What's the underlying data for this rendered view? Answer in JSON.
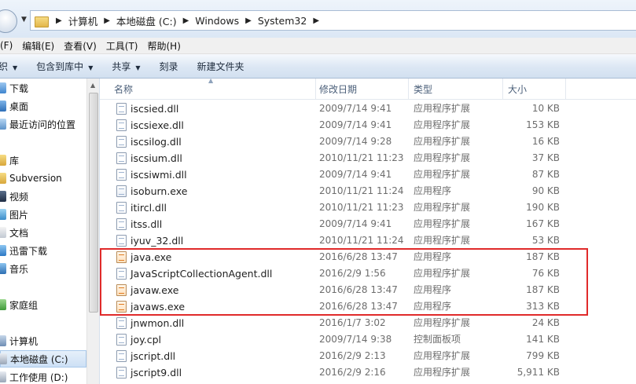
{
  "address": {
    "crumbs": [
      "计算机",
      "本地磁盘 (C:)",
      "Windows",
      "System32"
    ]
  },
  "menu": {
    "items": [
      "(F)",
      "编辑(E)",
      "查看(V)",
      "工具(T)",
      "帮助(H)"
    ]
  },
  "commands": {
    "organize": "织",
    "include_library": "包含到库中",
    "share": "共享",
    "burn": "刻录",
    "new_folder": "新建文件夹"
  },
  "nav": {
    "items": [
      {
        "label": "下载",
        "icon": "download-folder-icon"
      },
      {
        "label": "桌面",
        "icon": "desktop-icon"
      },
      {
        "label": "最近访问的位置",
        "icon": "recent-places-icon"
      },
      {
        "label": "库",
        "icon": "library-icon"
      },
      {
        "label": "Subversion",
        "icon": "subversion-icon"
      },
      {
        "label": "视频",
        "icon": "videos-icon"
      },
      {
        "label": "图片",
        "icon": "pictures-icon"
      },
      {
        "label": "文档",
        "icon": "documents-icon"
      },
      {
        "label": "迅雷下载",
        "icon": "thunder-download-icon"
      },
      {
        "label": "音乐",
        "icon": "music-icon"
      },
      {
        "label": "家庭组",
        "icon": "homegroup-icon"
      },
      {
        "label": "计算机",
        "icon": "computer-icon"
      },
      {
        "label": "本地磁盘 (C:)",
        "icon": "local-disk-icon"
      },
      {
        "label": "工作使用 (D:)",
        "icon": "drive-icon"
      }
    ]
  },
  "columns": {
    "name": "名称",
    "date": "修改日期",
    "type": "类型",
    "size": "大小"
  },
  "files": [
    {
      "name": "iscsied.dll",
      "date": "2009/7/14 9:41",
      "type": "应用程序扩展",
      "size": "10 KB",
      "icon": "dll-file-icon"
    },
    {
      "name": "iscsiexe.dll",
      "date": "2009/7/14 9:41",
      "type": "应用程序扩展",
      "size": "153 KB",
      "icon": "dll-file-icon"
    },
    {
      "name": "iscsilog.dll",
      "date": "2009/7/14 9:28",
      "type": "应用程序扩展",
      "size": "16 KB",
      "icon": "dll-file-icon"
    },
    {
      "name": "iscsium.dll",
      "date": "2010/11/21 11:23",
      "type": "应用程序扩展",
      "size": "37 KB",
      "icon": "dll-file-icon"
    },
    {
      "name": "iscsiwmi.dll",
      "date": "2009/7/14 9:41",
      "type": "应用程序扩展",
      "size": "87 KB",
      "icon": "dll-file-icon"
    },
    {
      "name": "isoburn.exe",
      "date": "2010/11/21 11:24",
      "type": "应用程序",
      "size": "90 KB",
      "icon": "exe-file-icon"
    },
    {
      "name": "itircl.dll",
      "date": "2010/11/21 11:23",
      "type": "应用程序扩展",
      "size": "190 KB",
      "icon": "dll-file-icon"
    },
    {
      "name": "itss.dll",
      "date": "2009/7/14 9:41",
      "type": "应用程序扩展",
      "size": "167 KB",
      "icon": "dll-file-icon"
    },
    {
      "name": "iyuv_32.dll",
      "date": "2010/11/21 11:24",
      "type": "应用程序扩展",
      "size": "53 KB",
      "icon": "dll-file-icon"
    },
    {
      "name": "java.exe",
      "date": "2016/6/28 13:47",
      "type": "应用程序",
      "size": "187 KB",
      "icon": "java-exe-icon"
    },
    {
      "name": "JavaScriptCollectionAgent.dll",
      "date": "2016/2/9 1:56",
      "type": "应用程序扩展",
      "size": "76 KB",
      "icon": "dll-file-icon"
    },
    {
      "name": "javaw.exe",
      "date": "2016/6/28 13:47",
      "type": "应用程序",
      "size": "187 KB",
      "icon": "java-exe-icon"
    },
    {
      "name": "javaws.exe",
      "date": "2016/6/28 13:47",
      "type": "应用程序",
      "size": "313 KB",
      "icon": "java-exe-icon"
    },
    {
      "name": "jnwmon.dll",
      "date": "2016/1/7 3:02",
      "type": "应用程序扩展",
      "size": "24 KB",
      "icon": "dll-file-icon"
    },
    {
      "name": "joy.cpl",
      "date": "2009/7/14 9:38",
      "type": "控制面板项",
      "size": "141 KB",
      "icon": "cpl-file-icon"
    },
    {
      "name": "jscript.dll",
      "date": "2016/2/9 2:13",
      "type": "应用程序扩展",
      "size": "799 KB",
      "icon": "dll-file-icon"
    },
    {
      "name": "jscript9.dll",
      "date": "2016/2/9 2:16",
      "type": "应用程序扩展",
      "size": "5,911 KB",
      "icon": "dll-file-icon"
    }
  ],
  "colors": {
    "highlight_border": "#e02a2a",
    "header_text": "#4c607a"
  }
}
